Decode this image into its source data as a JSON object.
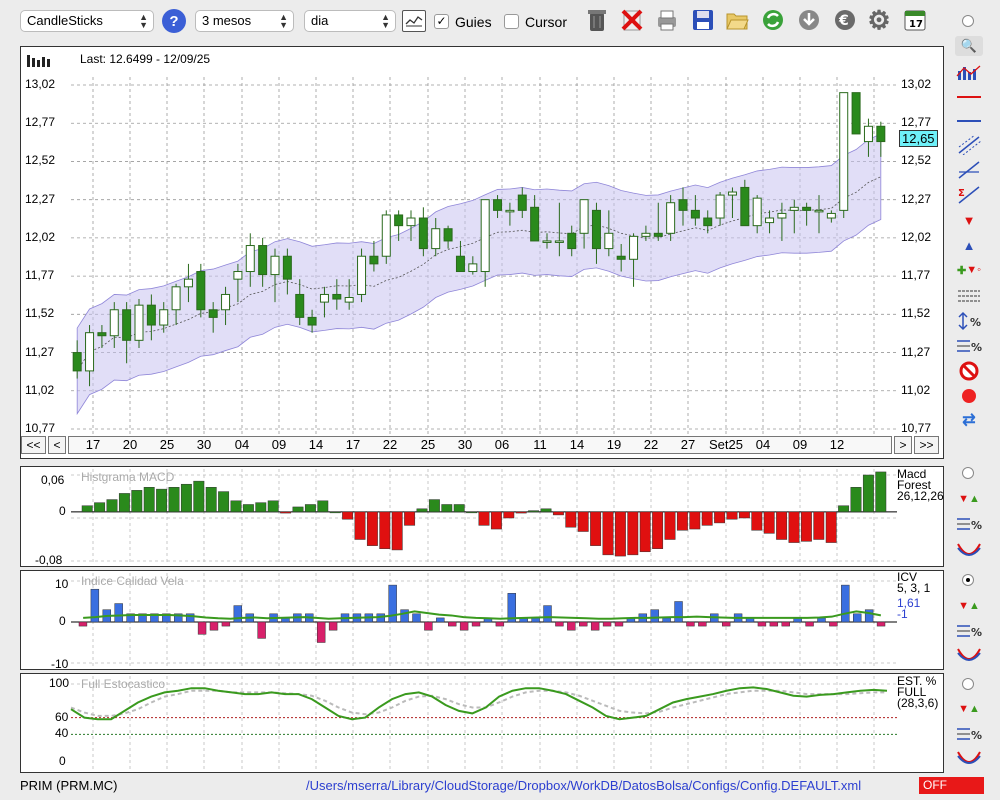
{
  "toolbar": {
    "chart_type": "CandleSticks",
    "period": "3 mesos",
    "interval": "dia",
    "guides_label": "Guies",
    "guides_checked": true,
    "cursor_label": "Cursor",
    "cursor_checked": false,
    "calendar_day": "17",
    "icons": [
      "help-icon",
      "chart-settings-icon",
      "trash-icon",
      "delete-icon",
      "print-icon",
      "save-icon",
      "open-folder-icon",
      "refresh-icon",
      "download-icon",
      "euro-icon",
      "gear-icon",
      "calendar-icon"
    ]
  },
  "main_chart": {
    "last_label": "Last: 12.6499 - 12/09/25",
    "current_price": "12,65",
    "y_ticks": [
      "13,02",
      "12,77",
      "12,52",
      "12,27",
      "12,02",
      "11,77",
      "11,52",
      "11,27",
      "11,02",
      "10,77"
    ],
    "x_ticks": [
      "17",
      "20",
      "25",
      "30",
      "04",
      "09",
      "14",
      "17",
      "22",
      "25",
      "30",
      "06",
      "11",
      "14",
      "19",
      "22",
      "27",
      "Set25",
      "04",
      "09",
      "12"
    ],
    "nav": {
      "first": "<<",
      "prev": "<",
      "next": ">",
      "last": ">>"
    }
  },
  "macd": {
    "title": "Histgrama MACD",
    "tag_lines": [
      "Macd",
      "Forest",
      "26,12,26"
    ],
    "y_ticks": [
      "0,06",
      "0",
      "-0,08"
    ]
  },
  "icv": {
    "title": "Indice Calidad Vela",
    "tag_lines": [
      "ICV",
      "5, 3, 1"
    ],
    "value1": "1,61",
    "value2": "-1",
    "y_ticks": [
      "10",
      "0",
      "-10"
    ]
  },
  "stoch": {
    "title": "Full Estocastico",
    "tag_lines": [
      "EST. %",
      "FULL",
      "(28,3,6)"
    ],
    "y_ticks": [
      "100",
      "60",
      "40",
      "0"
    ]
  },
  "status": {
    "ticker": "PRIM (PRM.MC)",
    "config_path": "/Users/mserra/Library/CloudStorage/Dropbox/WorkDB/DatosBolsa/Configs/Config.DEFAULT.xml",
    "off_label": "OFF"
  },
  "colors": {
    "up": "#2a8a1c",
    "down": "#ffffff",
    "band": "#c9c2f0",
    "macd_pos": "#2a8a1c",
    "macd_neg": "#e01010",
    "icv_pos": "#3a6fe0",
    "icv_neg": "#d8206a",
    "stoch": "#3a9a1e"
  },
  "chart_data": [
    {
      "type": "candlestick",
      "title": "",
      "ylim": [
        10.77,
        13.02
      ],
      "candles": [
        [
          11.27,
          11.35,
          11.1,
          11.15
        ],
        [
          11.15,
          11.45,
          11.05,
          11.4
        ],
        [
          11.4,
          11.45,
          11.3,
          11.38
        ],
        [
          11.38,
          11.6,
          11.3,
          11.55
        ],
        [
          11.55,
          11.6,
          11.2,
          11.35
        ],
        [
          11.35,
          11.62,
          11.3,
          11.58
        ],
        [
          11.58,
          11.65,
          11.35,
          11.45
        ],
        [
          11.45,
          11.6,
          11.4,
          11.55
        ],
        [
          11.55,
          11.72,
          11.45,
          11.7
        ],
        [
          11.7,
          11.85,
          11.6,
          11.75
        ],
        [
          11.8,
          11.85,
          11.5,
          11.55
        ],
        [
          11.55,
          11.6,
          11.4,
          11.5
        ],
        [
          11.55,
          11.7,
          11.45,
          11.65
        ],
        [
          11.75,
          11.85,
          11.6,
          11.8
        ],
        [
          11.8,
          12.05,
          11.7,
          11.97
        ],
        [
          11.97,
          12.02,
          11.7,
          11.78
        ],
        [
          11.78,
          11.95,
          11.6,
          11.9
        ],
        [
          11.9,
          11.95,
          11.65,
          11.75
        ],
        [
          11.65,
          11.75,
          11.45,
          11.5
        ],
        [
          11.5,
          11.55,
          11.4,
          11.45
        ],
        [
          11.6,
          11.7,
          11.5,
          11.65
        ],
        [
          11.65,
          11.75,
          11.55,
          11.62
        ],
        [
          11.6,
          11.75,
          11.55,
          11.63
        ],
        [
          11.65,
          11.95,
          11.6,
          11.9
        ],
        [
          11.9,
          12.0,
          11.8,
          11.85
        ],
        [
          11.9,
          12.2,
          11.85,
          12.17
        ],
        [
          12.17,
          12.2,
          12.0,
          12.1
        ],
        [
          12.1,
          12.2,
          12.0,
          12.15
        ],
        [
          12.15,
          12.22,
          11.9,
          11.95
        ],
        [
          11.95,
          12.15,
          11.9,
          12.08
        ],
        [
          12.08,
          12.1,
          11.95,
          12.0
        ],
        [
          11.9,
          12.0,
          11.8,
          11.8
        ],
        [
          11.8,
          11.9,
          11.78,
          11.85
        ],
        [
          11.8,
          12.27,
          11.7,
          12.27
        ],
        [
          12.27,
          12.3,
          12.15,
          12.2
        ],
        [
          12.2,
          12.25,
          12.1,
          12.2
        ],
        [
          12.3,
          12.35,
          12.15,
          12.2
        ],
        [
          12.22,
          12.3,
          12.0,
          12.0
        ],
        [
          12.0,
          12.05,
          11.95,
          12.0
        ],
        [
          12.0,
          12.25,
          11.9,
          12.0
        ],
        [
          12.05,
          12.1,
          11.9,
          11.95
        ],
        [
          12.05,
          12.27,
          11.95,
          12.27
        ],
        [
          12.2,
          12.25,
          11.85,
          11.95
        ],
        [
          11.95,
          12.2,
          11.9,
          12.05
        ],
        [
          11.9,
          11.98,
          11.8,
          11.88
        ],
        [
          11.88,
          12.05,
          11.7,
          12.03
        ],
        [
          12.03,
          12.1,
          12.0,
          12.05
        ],
        [
          12.05,
          12.25,
          12.0,
          12.03
        ],
        [
          12.05,
          12.3,
          12.0,
          12.25
        ],
        [
          12.27,
          12.35,
          12.1,
          12.2
        ],
        [
          12.2,
          12.3,
          12.1,
          12.15
        ],
        [
          12.15,
          12.2,
          12.05,
          12.1
        ],
        [
          12.15,
          12.32,
          12.1,
          12.3
        ],
        [
          12.3,
          12.35,
          12.15,
          12.32
        ],
        [
          12.35,
          12.4,
          12.15,
          12.1
        ],
        [
          12.1,
          12.3,
          12.05,
          12.28
        ],
        [
          12.12,
          12.2,
          12.05,
          12.15
        ],
        [
          12.15,
          12.25,
          12.0,
          12.18
        ],
        [
          12.2,
          12.27,
          12.05,
          12.22
        ],
        [
          12.22,
          12.25,
          12.1,
          12.2
        ],
        [
          12.2,
          12.3,
          12.05,
          12.2
        ],
        [
          12.15,
          12.2,
          12.12,
          12.18
        ],
        [
          12.2,
          12.95,
          12.15,
          12.97
        ],
        [
          12.97,
          12.95,
          12.75,
          12.7
        ],
        [
          12.65,
          12.8,
          12.55,
          12.75
        ],
        [
          12.75,
          12.78,
          12.55,
          12.65
        ]
      ]
    },
    {
      "type": "bar",
      "title": "Histgrama MACD",
      "ylim": [
        -0.08,
        0.06
      ],
      "values": [
        0.01,
        0.015,
        0.02,
        0.03,
        0.035,
        0.04,
        0.037,
        0.04,
        0.045,
        0.05,
        0.04,
        0.033,
        0.018,
        0.012,
        0.015,
        0.018,
        -0.002,
        0.008,
        0.012,
        0.018,
        0,
        -0.012,
        -0.045,
        -0.055,
        -0.06,
        -0.062,
        -0.022,
        0.005,
        0.02,
        0.012,
        0.012,
        0,
        -0.022,
        -0.028,
        -0.01,
        -0.002,
        0.002,
        0.005,
        -0.005,
        -0.025,
        -0.032,
        -0.055,
        -0.07,
        -0.072,
        -0.07,
        -0.065,
        -0.06,
        -0.045,
        -0.03,
        -0.028,
        -0.022,
        -0.018,
        -0.012,
        -0.01,
        -0.03,
        -0.035,
        -0.045,
        -0.05,
        -0.048,
        -0.045,
        -0.05,
        0.01,
        0.04,
        0.06,
        0.065
      ]
    },
    {
      "type": "bar",
      "title": "Indice Calidad Vela",
      "ylim": [
        -10,
        10
      ],
      "values": [
        -1,
        8,
        3,
        4.5,
        2,
        2,
        2,
        2,
        2,
        2,
        -3,
        -2,
        -1,
        4,
        2,
        -4,
        2,
        1,
        2,
        2,
        -5,
        -2,
        2,
        2,
        2,
        2,
        9,
        3,
        2,
        -2,
        1,
        -1,
        -2,
        -1,
        1,
        -1,
        7,
        1,
        1,
        4,
        -1,
        -2,
        -1,
        -2,
        -1,
        -1,
        1,
        2,
        3,
        1,
        5,
        -1,
        -1,
        2,
        -1,
        2,
        1,
        -1,
        -1,
        -1,
        1,
        -1,
        1,
        -1,
        9,
        2,
        3,
        -1
      ],
      "line": [
        1,
        1.2,
        1.5,
        1.6,
        1.7,
        1.7,
        1.7,
        1.7,
        1.6,
        1.4,
        1.1,
        0.9,
        0.8,
        1.0,
        1.1,
        0.9,
        1.0,
        1.1,
        1.2,
        1.0,
        0.8,
        0.9,
        1.0,
        1.1,
        1.2,
        1.5,
        2.0,
        2.6,
        2.2,
        1.8,
        1.6,
        1.2,
        1.0,
        0.9,
        0.8,
        0.9,
        1.0,
        1.1,
        1.2,
        1.1,
        1.0,
        0.9,
        0.8,
        0.8,
        0.9,
        1.0,
        1.0,
        1.1,
        1.2,
        1.2,
        1.3,
        1.2,
        1.1,
        1.0,
        1.0,
        1.0,
        1.0,
        1.0,
        1.0,
        1.0,
        1.1,
        1.3,
        2.0,
        2.6,
        2.2,
        1.61
      ]
    },
    {
      "type": "line",
      "title": "Full Estocastico",
      "ylim": [
        0,
        100
      ],
      "series": [
        {
          "name": "%K",
          "values": [
            70,
            60,
            58,
            58,
            68,
            78,
            85,
            90,
            92,
            95,
            95,
            92,
            90,
            88,
            88,
            90,
            88,
            88,
            82,
            72,
            62,
            58,
            60,
            72,
            82,
            88,
            90,
            85,
            75,
            68,
            65,
            72,
            85,
            92,
            95,
            95,
            92,
            88,
            80,
            72,
            62,
            58,
            60,
            62,
            70,
            78,
            82,
            85,
            88,
            92,
            95,
            96,
            94,
            90,
            86,
            85,
            87,
            88,
            90,
            92,
            93,
            92
          ]
        },
        {
          "name": "%D",
          "values": [
            72,
            66,
            62,
            62,
            65,
            70,
            78,
            85,
            88,
            92,
            92,
            92,
            90,
            90,
            90,
            90,
            89,
            88,
            86,
            80,
            72,
            66,
            64,
            66,
            72,
            80,
            85,
            86,
            82,
            76,
            72,
            72,
            78,
            85,
            90,
            92,
            92,
            90,
            86,
            80,
            74,
            68,
            66,
            65,
            67,
            72,
            76,
            80,
            84,
            88,
            90,
            92,
            92,
            92,
            90,
            88,
            88,
            88,
            88,
            89,
            90,
            90
          ]
        }
      ],
      "hlines": [
        60,
        40
      ]
    }
  ]
}
